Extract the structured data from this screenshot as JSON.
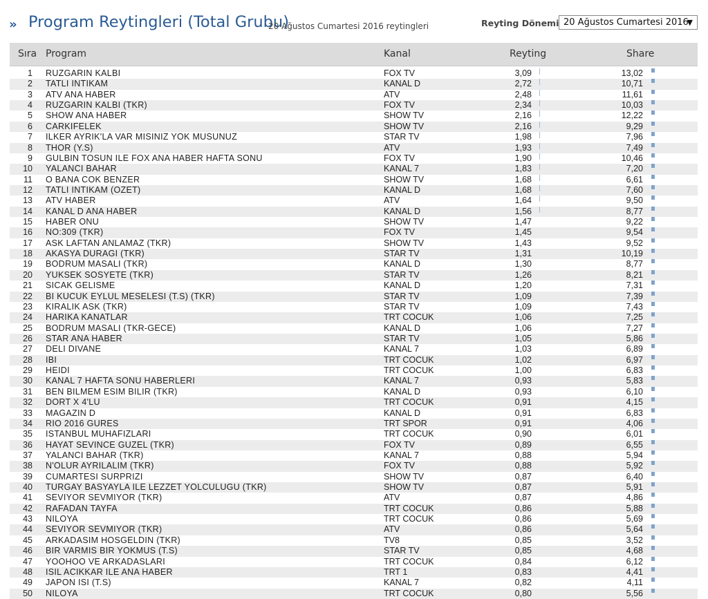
{
  "header": {
    "arrows": "»",
    "title": "Program Reytingleri (Total Grubu)",
    "subtitle": "20 Ağustos Cumartesi 2016 reytingleri",
    "period_label": "Reyting Dönemi :",
    "period_value": "20 Ağustos Cumartesi 2016",
    "caret": "▼"
  },
  "columns": {
    "sira": "Sıra",
    "program": "Program",
    "kanal": "Kanal",
    "reyting": "Reyting",
    "share": "Share"
  },
  "rows": [
    {
      "rank": "1",
      "program": "RUZGARIN KALBI",
      "channel": "FOX TV",
      "rating": "3,09",
      "share": "13,02"
    },
    {
      "rank": "2",
      "program": "TATLI INTIKAM",
      "channel": "KANAL D",
      "rating": "2,72",
      "share": "10,71"
    },
    {
      "rank": "3",
      "program": "ATV ANA HABER",
      "channel": "ATV",
      "rating": "2,48",
      "share": "11,61"
    },
    {
      "rank": "4",
      "program": "RUZGARIN KALBI (TKR)",
      "channel": "FOX TV",
      "rating": "2,34",
      "share": "10,03"
    },
    {
      "rank": "5",
      "program": "SHOW ANA HABER",
      "channel": "SHOW TV",
      "rating": "2,16",
      "share": "12,22"
    },
    {
      "rank": "6",
      "program": "CARKIFELEK",
      "channel": "SHOW TV",
      "rating": "2,16",
      "share": "9,29"
    },
    {
      "rank": "7",
      "program": "ILKER AYRIK'LA VAR MISINIZ YOK MUSUNUZ",
      "channel": "STAR TV",
      "rating": "1,98",
      "share": "7,96"
    },
    {
      "rank": "8",
      "program": "THOR (Y.S)",
      "channel": "ATV",
      "rating": "1,93",
      "share": "7,49"
    },
    {
      "rank": "9",
      "program": "GULBIN TOSUN ILE FOX ANA HABER HAFTA SONU",
      "channel": "FOX TV",
      "rating": "1,90",
      "share": "10,46"
    },
    {
      "rank": "10",
      "program": "YALANCI BAHAR",
      "channel": "KANAL 7",
      "rating": "1,83",
      "share": "7,20"
    },
    {
      "rank": "11",
      "program": "O BANA COK BENZER",
      "channel": "SHOW TV",
      "rating": "1,68",
      "share": "6,61"
    },
    {
      "rank": "12",
      "program": "TATLI INTIKAM (OZET)",
      "channel": "KANAL D",
      "rating": "1,68",
      "share": "7,60"
    },
    {
      "rank": "13",
      "program": "ATV HABER",
      "channel": "ATV",
      "rating": "1,64",
      "share": "9,50"
    },
    {
      "rank": "14",
      "program": "KANAL D ANA HABER",
      "channel": "KANAL D",
      "rating": "1,56",
      "share": "8,77"
    },
    {
      "rank": "15",
      "program": "HABER ONU",
      "channel": "SHOW TV",
      "rating": "1,47",
      "share": "9,22"
    },
    {
      "rank": "16",
      "program": "NO:309 (TKR)",
      "channel": "FOX TV",
      "rating": "1,45",
      "share": "9,54"
    },
    {
      "rank": "17",
      "program": "ASK LAFTAN ANLAMAZ (TKR)",
      "channel": "SHOW TV",
      "rating": "1,43",
      "share": "9,52"
    },
    {
      "rank": "18",
      "program": "AKASYA DURAGI (TKR)",
      "channel": "STAR TV",
      "rating": "1,31",
      "share": "10,19"
    },
    {
      "rank": "19",
      "program": "BODRUM MASALI (TKR)",
      "channel": "KANAL D",
      "rating": "1,30",
      "share": "8,77"
    },
    {
      "rank": "20",
      "program": "YUKSEK SOSYETE (TKR)",
      "channel": "STAR TV",
      "rating": "1,26",
      "share": "8,21"
    },
    {
      "rank": "21",
      "program": "SICAK GELISME",
      "channel": "KANAL D",
      "rating": "1,20",
      "share": "7,31"
    },
    {
      "rank": "22",
      "program": "BI KUCUK EYLUL MESELESI (T.S) (TKR)",
      "channel": "STAR TV",
      "rating": "1,09",
      "share": "7,39"
    },
    {
      "rank": "23",
      "program": "KIRALIK ASK (TKR)",
      "channel": "STAR TV",
      "rating": "1,09",
      "share": "7,43"
    },
    {
      "rank": "24",
      "program": "HARIKA KANATLAR",
      "channel": "TRT COCUK",
      "rating": "1,06",
      "share": "7,25"
    },
    {
      "rank": "25",
      "program": "BODRUM MASALI (TKR-GECE)",
      "channel": "KANAL D",
      "rating": "1,06",
      "share": "7,27"
    },
    {
      "rank": "26",
      "program": "STAR ANA HABER",
      "channel": "STAR TV",
      "rating": "1,05",
      "share": "5,86"
    },
    {
      "rank": "27",
      "program": "DELI DIVANE",
      "channel": "KANAL 7",
      "rating": "1,03",
      "share": "6,89"
    },
    {
      "rank": "28",
      "program": "IBI",
      "channel": "TRT COCUK",
      "rating": "1,02",
      "share": "6,97"
    },
    {
      "rank": "29",
      "program": "HEIDI",
      "channel": "TRT COCUK",
      "rating": "1,00",
      "share": "6,83"
    },
    {
      "rank": "30",
      "program": "KANAL 7 HAFTA SONU HABERLERI",
      "channel": "KANAL 7",
      "rating": "0,93",
      "share": "5,83"
    },
    {
      "rank": "31",
      "program": "BEN BILMEM ESIM BILIR (TKR)",
      "channel": "KANAL D",
      "rating": "0,93",
      "share": "6,10"
    },
    {
      "rank": "32",
      "program": "DORT X 4'LU",
      "channel": "TRT COCUK",
      "rating": "0,91",
      "share": "4,15"
    },
    {
      "rank": "33",
      "program": "MAGAZIN D",
      "channel": "KANAL D",
      "rating": "0,91",
      "share": "6,83"
    },
    {
      "rank": "34",
      "program": "RIO 2016 GURES",
      "channel": "TRT SPOR",
      "rating": "0,91",
      "share": "4,06"
    },
    {
      "rank": "35",
      "program": "ISTANBUL MUHAFIZLARI",
      "channel": "TRT COCUK",
      "rating": "0,90",
      "share": "6,01"
    },
    {
      "rank": "36",
      "program": "HAYAT SEVINCE GUZEL (TKR)",
      "channel": "FOX TV",
      "rating": "0,89",
      "share": "6,55"
    },
    {
      "rank": "37",
      "program": "YALANCI BAHAR (TKR)",
      "channel": "KANAL 7",
      "rating": "0,88",
      "share": "5,94"
    },
    {
      "rank": "38",
      "program": "N'OLUR AYRILALIM (TKR)",
      "channel": "FOX TV",
      "rating": "0,88",
      "share": "5,92"
    },
    {
      "rank": "39",
      "program": "CUMARTESI SURPRIZI",
      "channel": "SHOW TV",
      "rating": "0,87",
      "share": "6,40"
    },
    {
      "rank": "40",
      "program": "TURGAY BASYAYLA ILE LEZZET YOLCULUGU (TKR)",
      "channel": "SHOW TV",
      "rating": "0,87",
      "share": "5,91"
    },
    {
      "rank": "41",
      "program": "SEVIYOR SEVMIYOR (TKR)",
      "channel": "ATV",
      "rating": "0,87",
      "share": "4,86"
    },
    {
      "rank": "42",
      "program": "RAFADAN TAYFA",
      "channel": "TRT COCUK",
      "rating": "0,86",
      "share": "5,88"
    },
    {
      "rank": "43",
      "program": "NILOYA",
      "channel": "TRT COCUK",
      "rating": "0,86",
      "share": "5,69"
    },
    {
      "rank": "44",
      "program": "SEVIYOR SEVMIYOR (TKR)",
      "channel": "ATV",
      "rating": "0,86",
      "share": "5,64"
    },
    {
      "rank": "45",
      "program": "ARKADASIM HOSGELDIN (TKR)",
      "channel": "TV8",
      "rating": "0,85",
      "share": "3,52"
    },
    {
      "rank": "46",
      "program": "BIR VARMIS BIR YOKMUS (T.S)",
      "channel": "STAR TV",
      "rating": "0,85",
      "share": "4,68"
    },
    {
      "rank": "47",
      "program": "YOOHOO VE ARKADASLARI",
      "channel": "TRT COCUK",
      "rating": "0,84",
      "share": "6,12"
    },
    {
      "rank": "48",
      "program": "ISIL ACIKKAR ILE ANA HABER",
      "channel": "TRT 1",
      "rating": "0,83",
      "share": "4,41"
    },
    {
      "rank": "49",
      "program": "JAPON ISI (T.S)",
      "channel": "KANAL 7",
      "rating": "0,82",
      "share": "4,11"
    },
    {
      "rank": "50",
      "program": "NILOYA",
      "channel": "TRT COCUK",
      "rating": "0,80",
      "share": "5,56"
    }
  ]
}
